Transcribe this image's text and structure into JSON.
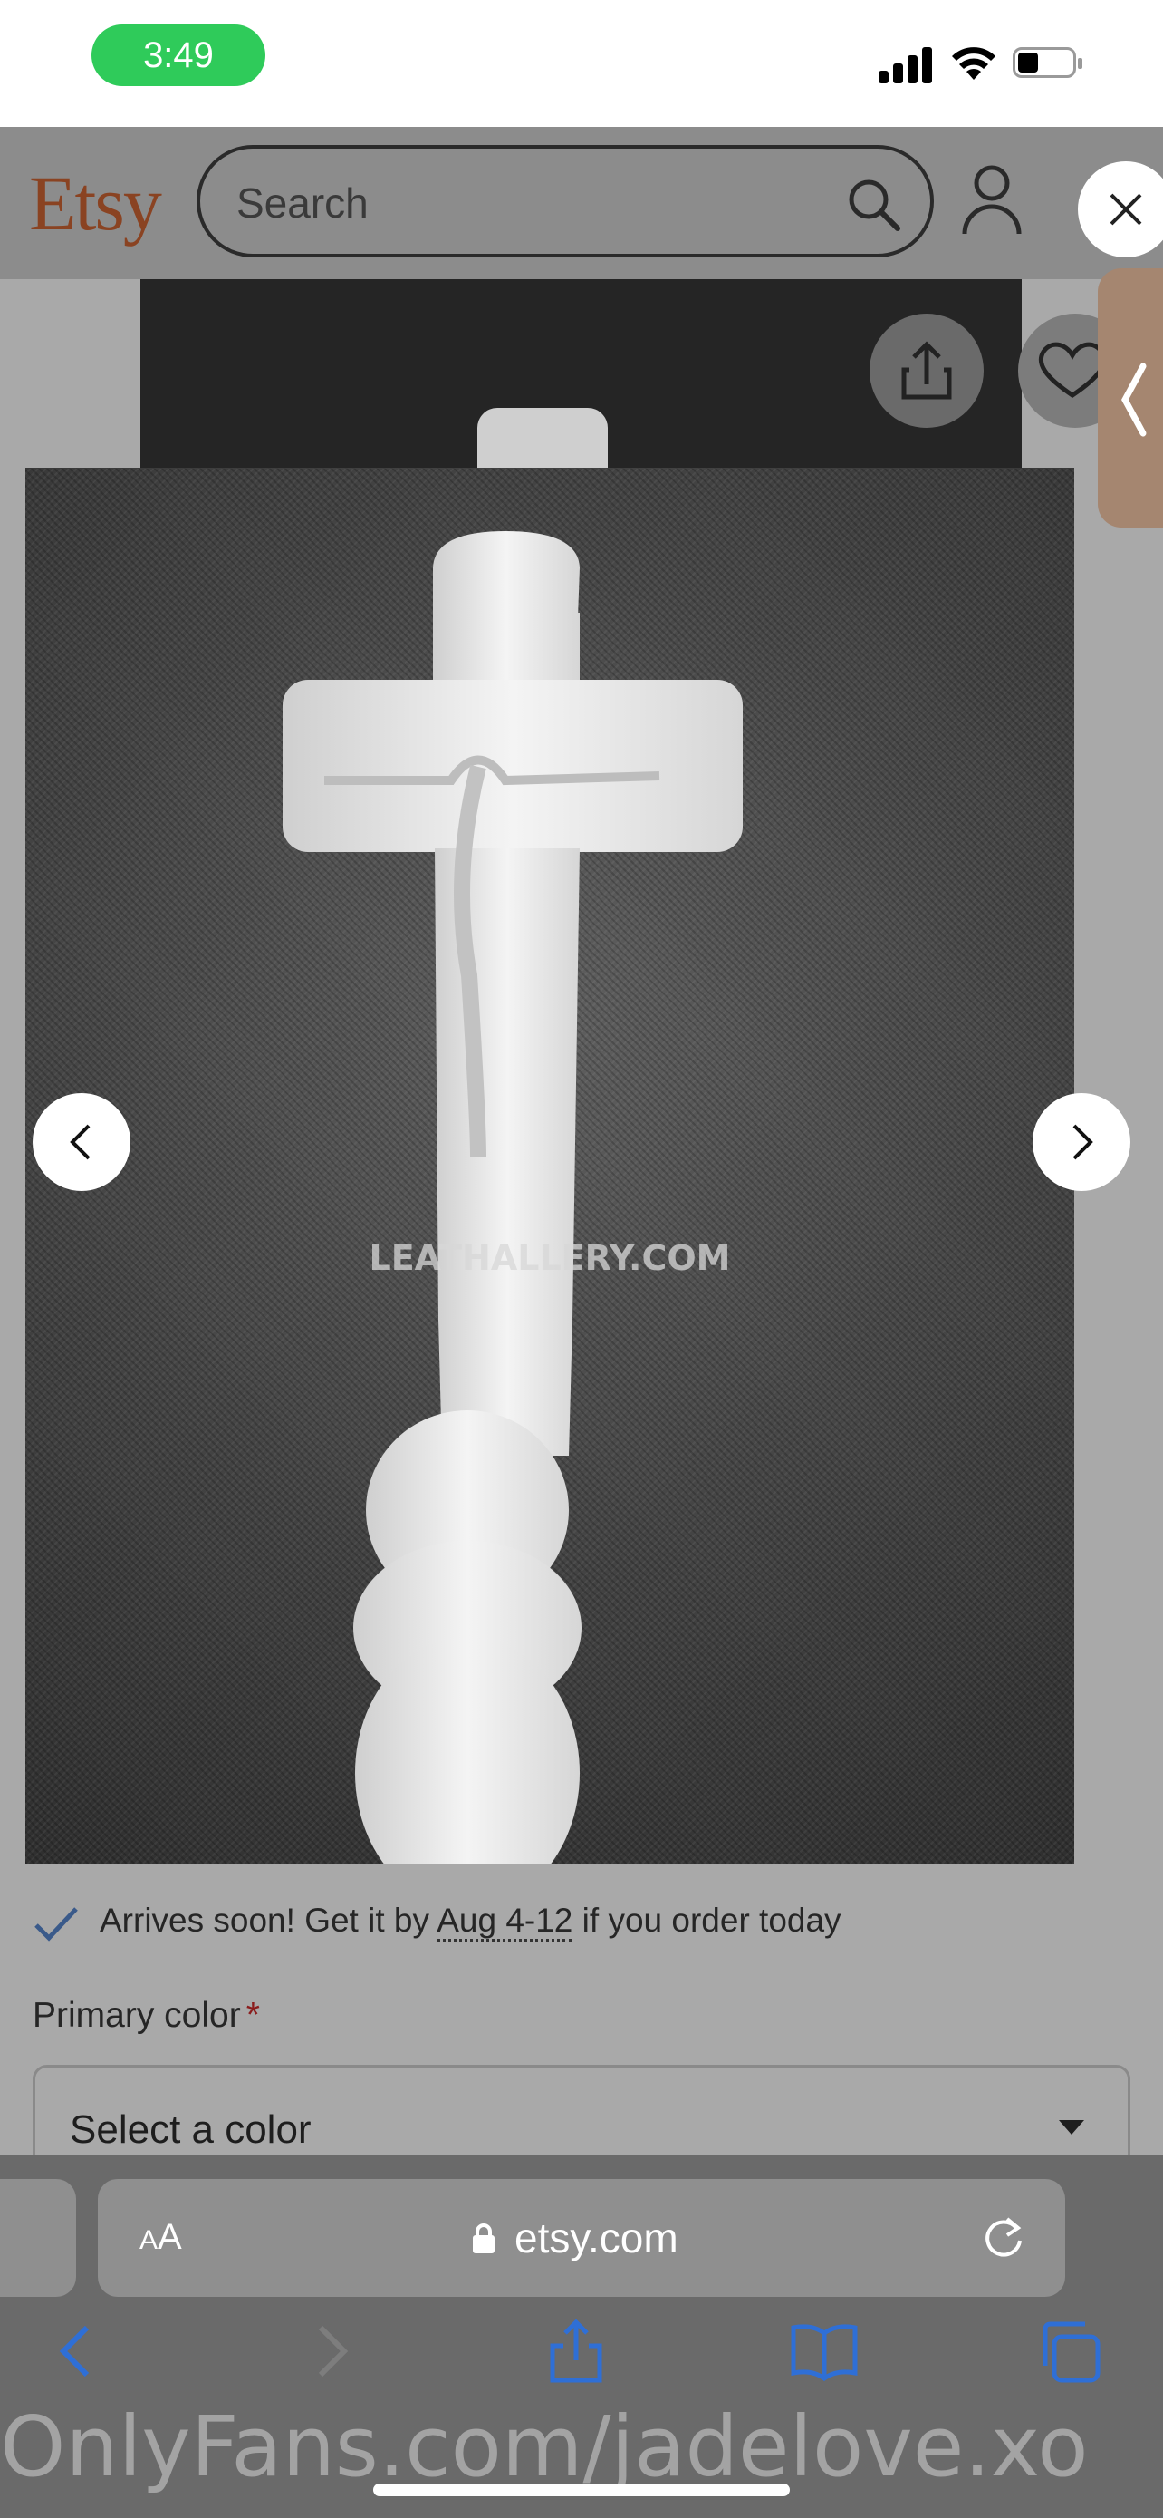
{
  "status_bar": {
    "time": "3:49"
  },
  "header": {
    "logo": "Etsy",
    "search": {
      "placeholder": "Search",
      "value": ""
    }
  },
  "gallery": {
    "watermark": "LEATHALLERY.COM"
  },
  "product": {
    "arrival_prefix": "Arrives soon! Get it by ",
    "arrival_date": "Aug 4-12",
    "arrival_suffix": " if you order today",
    "color_label": "Primary color",
    "required_mark": "*",
    "color_select_value": "Select a color"
  },
  "browser": {
    "aa_small": "A",
    "aa_large": "A",
    "domain": "etsy.com"
  },
  "overlay_watermark": "OnlyFans.com/jadelove.xo",
  "colors": {
    "etsy_orange": "#8a4322",
    "status_green": "#2fcb5a",
    "safari_blue": "#2f6fd6"
  }
}
